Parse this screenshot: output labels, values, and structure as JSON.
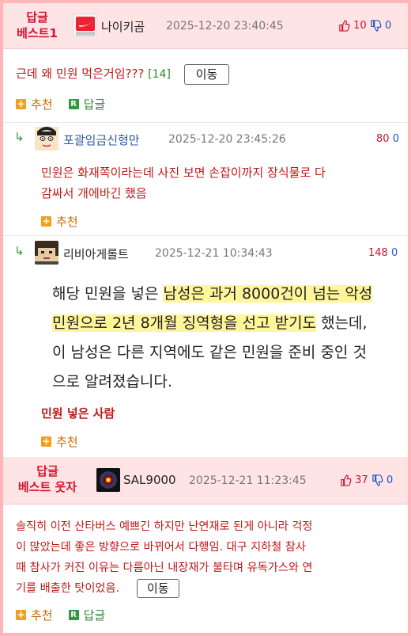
{
  "best1": {
    "label_line1": "답글",
    "label_line2": "베스트1",
    "nickname": "나이키곰",
    "datetime": "2025-12-20 23:40:45",
    "upvotes": "10",
    "downvotes": "0",
    "avatar_icon": "nike-logo-icon",
    "body": "근데 왜 민원 먹은거임???",
    "reply_count": "[14]",
    "move_label": "이동",
    "recommend_label": "추천",
    "reply_label": "답글"
  },
  "reply1": {
    "nickname": "포괄임금신형만",
    "datetime": "2025-12-20 23:45:26",
    "upvotes": "80",
    "downvotes": "0",
    "avatar_icon": "cartoon-face-icon",
    "text_line1": "민원은 화재쪽이라는데 사진 보면 손잡이까지 장식물로 다",
    "text_line2": "감싸서 개에바긴 했음",
    "recommend_label": "추천"
  },
  "reply2": {
    "nickname": "리비아게롤트",
    "datetime": "2025-12-21 10:34:43",
    "upvotes": "148",
    "downvotes": "0",
    "avatar_icon": "pixel-face-icon",
    "quote_l1_a": "해당 민원을 넣은 ",
    "quote_l1_b": "남성은 과거 8000건이 넘는 악성",
    "quote_l2_a": "민원으로 2년 8개월 징역형을 선고 받기도",
    "quote_l2_b": " 했는데,",
    "quote_l3": "이 남성은 다른 지역에도 같은 민원을 준비 중인 것",
    "quote_l4": "으로 알려졌습니다.",
    "caption": "민원 넣은 사람",
    "recommend_label": "추천"
  },
  "best2": {
    "label_line1": "답글",
    "label_line2": "베스트 웃자",
    "nickname": "SAL9000",
    "datetime": "2025-12-21 11:23:45",
    "upvotes": "37",
    "downvotes": "0",
    "avatar_icon": "hal9000-eye-icon",
    "text_line1": "솔직히 이전 산타버스 예쁘긴 하지만 난연재로 된게 아니라 걱정",
    "text_line2": "이 많았는데 좋은 방향으로 바뀌어서 다행임. 대구 지하철 참사",
    "text_line3": "때 참사가 커진 이유는 다름아닌 내장재가 불타며 유독가스와 연",
    "text_line4": "기를 배출한 탓이었음.",
    "move_label": "이동",
    "recommend_label": "추천",
    "reply_label": "답글"
  },
  "colors": {
    "accent_red": "#d2142f",
    "frame_pink": "#ffb6b9",
    "header_pink": "#ffe4e6",
    "highlight": "#fff59a"
  }
}
